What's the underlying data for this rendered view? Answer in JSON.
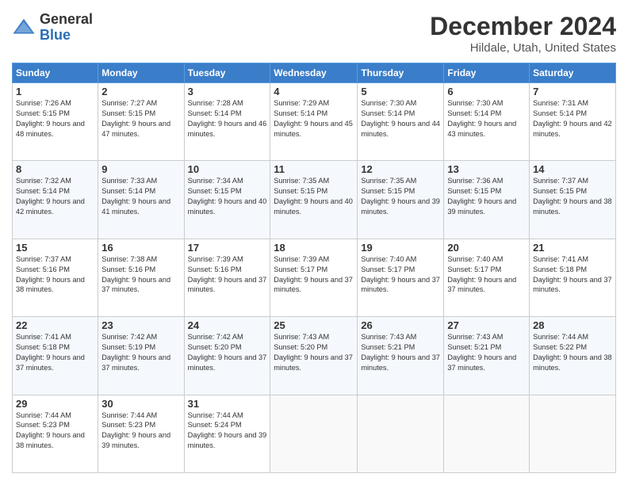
{
  "logo": {
    "general": "General",
    "blue": "Blue"
  },
  "title": "December 2024",
  "location": "Hildale, Utah, United States",
  "days_of_week": [
    "Sunday",
    "Monday",
    "Tuesday",
    "Wednesday",
    "Thursday",
    "Friday",
    "Saturday"
  ],
  "weeks": [
    [
      {
        "day": "1",
        "sunrise": "7:26 AM",
        "sunset": "5:15 PM",
        "daylight": "9 hours and 48 minutes."
      },
      {
        "day": "2",
        "sunrise": "7:27 AM",
        "sunset": "5:15 PM",
        "daylight": "9 hours and 47 minutes."
      },
      {
        "day": "3",
        "sunrise": "7:28 AM",
        "sunset": "5:14 PM",
        "daylight": "9 hours and 46 minutes."
      },
      {
        "day": "4",
        "sunrise": "7:29 AM",
        "sunset": "5:14 PM",
        "daylight": "9 hours and 45 minutes."
      },
      {
        "day": "5",
        "sunrise": "7:30 AM",
        "sunset": "5:14 PM",
        "daylight": "9 hours and 44 minutes."
      },
      {
        "day": "6",
        "sunrise": "7:30 AM",
        "sunset": "5:14 PM",
        "daylight": "9 hours and 43 minutes."
      },
      {
        "day": "7",
        "sunrise": "7:31 AM",
        "sunset": "5:14 PM",
        "daylight": "9 hours and 42 minutes."
      }
    ],
    [
      {
        "day": "8",
        "sunrise": "7:32 AM",
        "sunset": "5:14 PM",
        "daylight": "9 hours and 42 minutes."
      },
      {
        "day": "9",
        "sunrise": "7:33 AM",
        "sunset": "5:14 PM",
        "daylight": "9 hours and 41 minutes."
      },
      {
        "day": "10",
        "sunrise": "7:34 AM",
        "sunset": "5:15 PM",
        "daylight": "9 hours and 40 minutes."
      },
      {
        "day": "11",
        "sunrise": "7:35 AM",
        "sunset": "5:15 PM",
        "daylight": "9 hours and 40 minutes."
      },
      {
        "day": "12",
        "sunrise": "7:35 AM",
        "sunset": "5:15 PM",
        "daylight": "9 hours and 39 minutes."
      },
      {
        "day": "13",
        "sunrise": "7:36 AM",
        "sunset": "5:15 PM",
        "daylight": "9 hours and 39 minutes."
      },
      {
        "day": "14",
        "sunrise": "7:37 AM",
        "sunset": "5:15 PM",
        "daylight": "9 hours and 38 minutes."
      }
    ],
    [
      {
        "day": "15",
        "sunrise": "7:37 AM",
        "sunset": "5:16 PM",
        "daylight": "9 hours and 38 minutes."
      },
      {
        "day": "16",
        "sunrise": "7:38 AM",
        "sunset": "5:16 PM",
        "daylight": "9 hours and 37 minutes."
      },
      {
        "day": "17",
        "sunrise": "7:39 AM",
        "sunset": "5:16 PM",
        "daylight": "9 hours and 37 minutes."
      },
      {
        "day": "18",
        "sunrise": "7:39 AM",
        "sunset": "5:17 PM",
        "daylight": "9 hours and 37 minutes."
      },
      {
        "day": "19",
        "sunrise": "7:40 AM",
        "sunset": "5:17 PM",
        "daylight": "9 hours and 37 minutes."
      },
      {
        "day": "20",
        "sunrise": "7:40 AM",
        "sunset": "5:17 PM",
        "daylight": "9 hours and 37 minutes."
      },
      {
        "day": "21",
        "sunrise": "7:41 AM",
        "sunset": "5:18 PM",
        "daylight": "9 hours and 37 minutes."
      }
    ],
    [
      {
        "day": "22",
        "sunrise": "7:41 AM",
        "sunset": "5:18 PM",
        "daylight": "9 hours and 37 minutes."
      },
      {
        "day": "23",
        "sunrise": "7:42 AM",
        "sunset": "5:19 PM",
        "daylight": "9 hours and 37 minutes."
      },
      {
        "day": "24",
        "sunrise": "7:42 AM",
        "sunset": "5:20 PM",
        "daylight": "9 hours and 37 minutes."
      },
      {
        "day": "25",
        "sunrise": "7:43 AM",
        "sunset": "5:20 PM",
        "daylight": "9 hours and 37 minutes."
      },
      {
        "day": "26",
        "sunrise": "7:43 AM",
        "sunset": "5:21 PM",
        "daylight": "9 hours and 37 minutes."
      },
      {
        "day": "27",
        "sunrise": "7:43 AM",
        "sunset": "5:21 PM",
        "daylight": "9 hours and 37 minutes."
      },
      {
        "day": "28",
        "sunrise": "7:44 AM",
        "sunset": "5:22 PM",
        "daylight": "9 hours and 38 minutes."
      }
    ],
    [
      {
        "day": "29",
        "sunrise": "7:44 AM",
        "sunset": "5:23 PM",
        "daylight": "9 hours and 38 minutes."
      },
      {
        "day": "30",
        "sunrise": "7:44 AM",
        "sunset": "5:23 PM",
        "daylight": "9 hours and 39 minutes."
      },
      {
        "day": "31",
        "sunrise": "7:44 AM",
        "sunset": "5:24 PM",
        "daylight": "9 hours and 39 minutes."
      },
      null,
      null,
      null,
      null
    ]
  ],
  "labels": {
    "sunrise": "Sunrise:",
    "sunset": "Sunset:",
    "daylight": "Daylight:"
  }
}
